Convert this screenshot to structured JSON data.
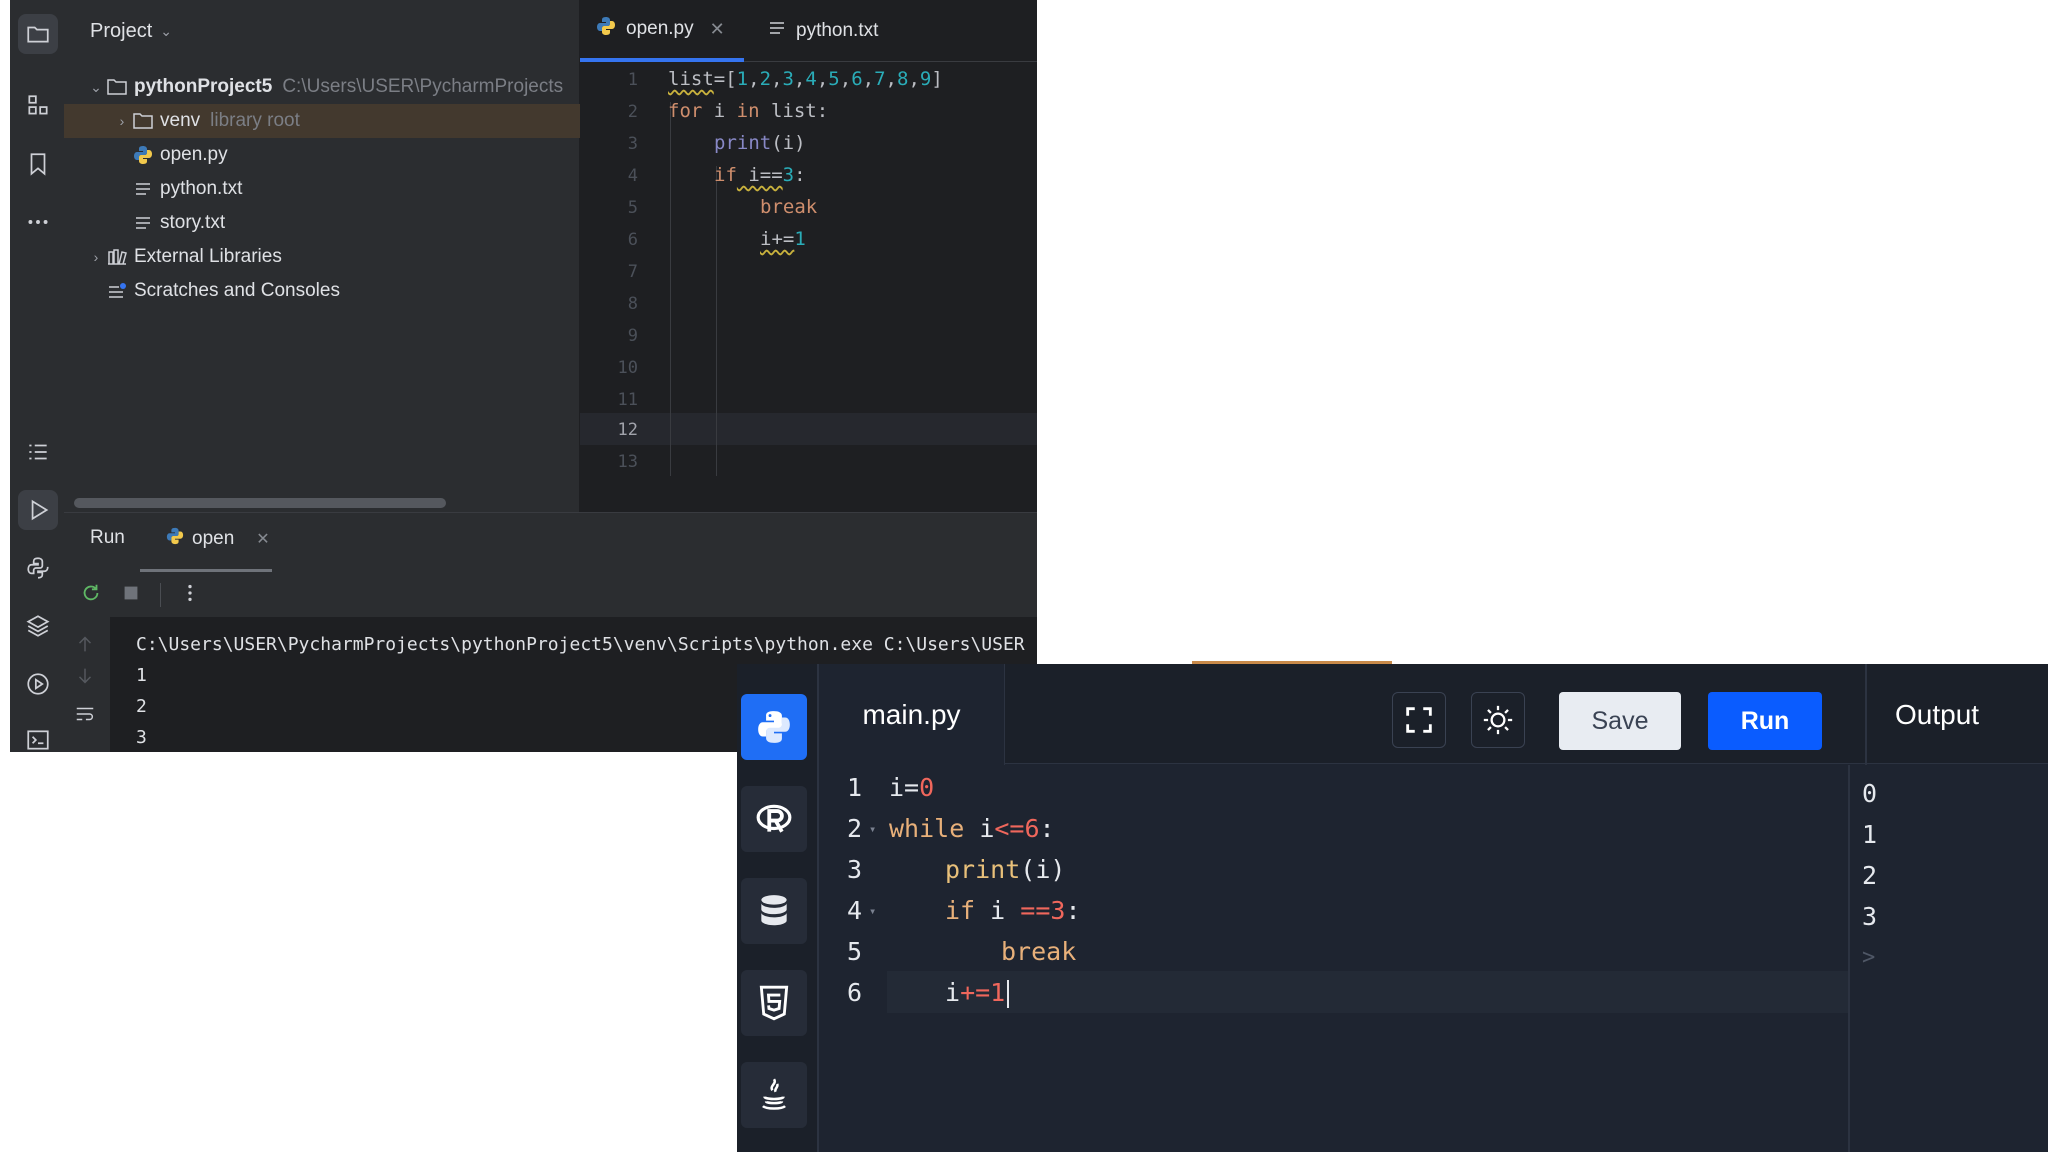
{
  "pycharm": {
    "project_title": "Project",
    "tree": {
      "root_name": "pythonProject5",
      "root_path": "C:\\Users\\USER\\PycharmProjects",
      "venv_name": "venv",
      "venv_hint": "library root",
      "file1": "open.py",
      "file2": "python.txt",
      "file3": "story.txt",
      "ext_libs": "External Libraries",
      "scratches": "Scratches and Consoles"
    },
    "tabs": {
      "active": "open.py",
      "other": "python.txt"
    },
    "line_numbers": [
      "1",
      "2",
      "3",
      "4",
      "5",
      "6",
      "7",
      "8",
      "9",
      "10",
      "11",
      "12",
      "13"
    ],
    "code": {
      "l1": {
        "a": "list",
        "b": "=[",
        "n1": "1",
        "n2": "2",
        "n3": "3",
        "n4": "4",
        "n5": "5",
        "n6": "6",
        "n7": "7",
        "n8": "8",
        "n9": "9",
        "c": "]"
      },
      "l2": {
        "kw1": "for",
        "a": " i ",
        "kw2": "in",
        "b": " list:"
      },
      "l3": {
        "fn": "print",
        "b": "(i)"
      },
      "l4": {
        "kw": "if",
        "a": " i==",
        "n": "3",
        "b": ":"
      },
      "l5": {
        "kw": "break"
      },
      "l6": {
        "a": "i+=",
        "n": "1"
      }
    },
    "run": {
      "tab_run": "Run",
      "tab_open": "open",
      "cmd": "C:\\Users\\USER\\PycharmProjects\\pythonProject5\\venv\\Scripts\\python.exe C:\\Users\\USER",
      "out": [
        "1",
        "2",
        "3"
      ]
    }
  },
  "compiler": {
    "file_tab": "main.py",
    "save_label": "Save",
    "run_label": "Run",
    "output_title": "Output",
    "line_numbers": [
      "1",
      "2",
      "3",
      "4",
      "5",
      "6"
    ],
    "code": {
      "l1": {
        "a": "i=",
        "n": "0"
      },
      "l2": {
        "kw": "while",
        "a": " i",
        "op": "<=",
        "n": "6",
        "b": ":"
      },
      "l3": {
        "fn": "print",
        "b": "(i)"
      },
      "l4": {
        "kw": "if",
        "a": " i ",
        "op": "==",
        "n": "3",
        "b": ":"
      },
      "l5": {
        "kw": "break"
      },
      "l6": {
        "a": "i",
        "op": "+=",
        "n": "1"
      }
    },
    "output": [
      "0",
      "1",
      "2",
      "3"
    ],
    "prompt": ">"
  },
  "colors": {
    "pycharm_bg": "#1e1f22",
    "pycharm_panel": "#2b2d30",
    "accent_blue": "#3574f0",
    "compiler_bg": "#1e2430",
    "run_button": "#0a5cff"
  },
  "icons": {
    "toolbar": [
      "folder-icon",
      "structure-icon",
      "bookmark-icon",
      "more-icon",
      "list-icon",
      "run-icon",
      "python-console-icon",
      "layers-icon",
      "services-icon",
      "terminal-icon"
    ],
    "compiler_side": [
      "python-icon",
      "r-icon",
      "database-icon",
      "html5-icon",
      "java-icon"
    ],
    "compiler_header": [
      "fullscreen-icon",
      "theme-toggle-icon"
    ]
  }
}
